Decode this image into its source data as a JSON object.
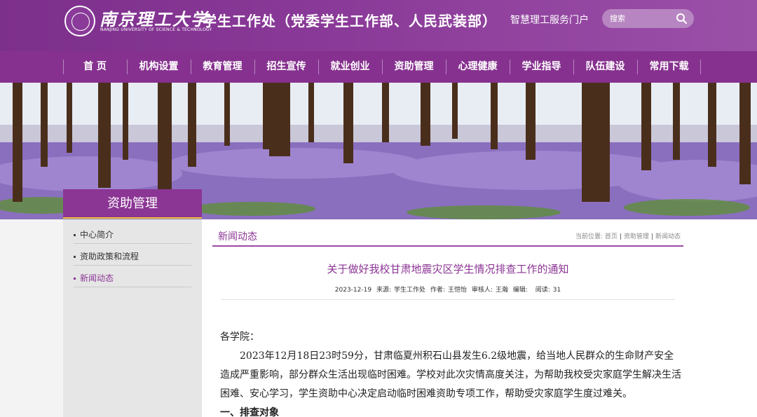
{
  "header": {
    "university_cn": "南京理工大学",
    "university_en": "NANJING UNIVERSITY OF SCIENCE & TECHNOLOGY",
    "department": "学生工作处（党委学生工作部、人民武装部）",
    "portal_link": "智慧理工服务门户",
    "search_placeholder": "搜索"
  },
  "nav": {
    "items": [
      "首 页",
      "机构设置",
      "教育管理",
      "招生宣传",
      "就业创业",
      "资助管理",
      "心理健康",
      "学业指导",
      "队伍建设",
      "常用下载"
    ]
  },
  "sidebar": {
    "title": "资助管理",
    "items": [
      {
        "label": "中心简介",
        "active": false
      },
      {
        "label": "资助政策和流程",
        "active": false
      },
      {
        "label": "新闻动态",
        "active": true
      }
    ]
  },
  "main": {
    "section_title": "新闻动态",
    "breadcrumb": {
      "prefix": "当前位置:",
      "items": [
        "首页",
        "资助管理",
        "新闻动态"
      ]
    },
    "article": {
      "title": "关于做好我校甘肃地震灾区学生情况排查工作的通知",
      "date": "2023-12-19",
      "source_label": "来源:",
      "source": "学生工作处",
      "author_label": "作者:",
      "author": "王恺怡",
      "reviewer_label": "审核人:",
      "reviewer": "王瀚",
      "editor_label": "编辑:",
      "editor": "",
      "views_label": "阅读:",
      "views": "31",
      "greeting": "各学院：",
      "paragraph1": "2023年12月18日23时59分，甘肃临夏州积石山县发生6.2级地震，给当地人民群众的生命财产安全造成严重影响，部分群众生活出现临时困难。学校对此次灾情高度关注，为帮助我校受灾家庭学生解决生活困难、安心学习，学生资助中心决定启动临时困难资助专项工作，帮助受灾家庭学生度过难关。",
      "heading1": "一、排查对象"
    }
  },
  "colors": {
    "brand_purple": "#86318f",
    "accent_gold": "#f0c43a"
  }
}
